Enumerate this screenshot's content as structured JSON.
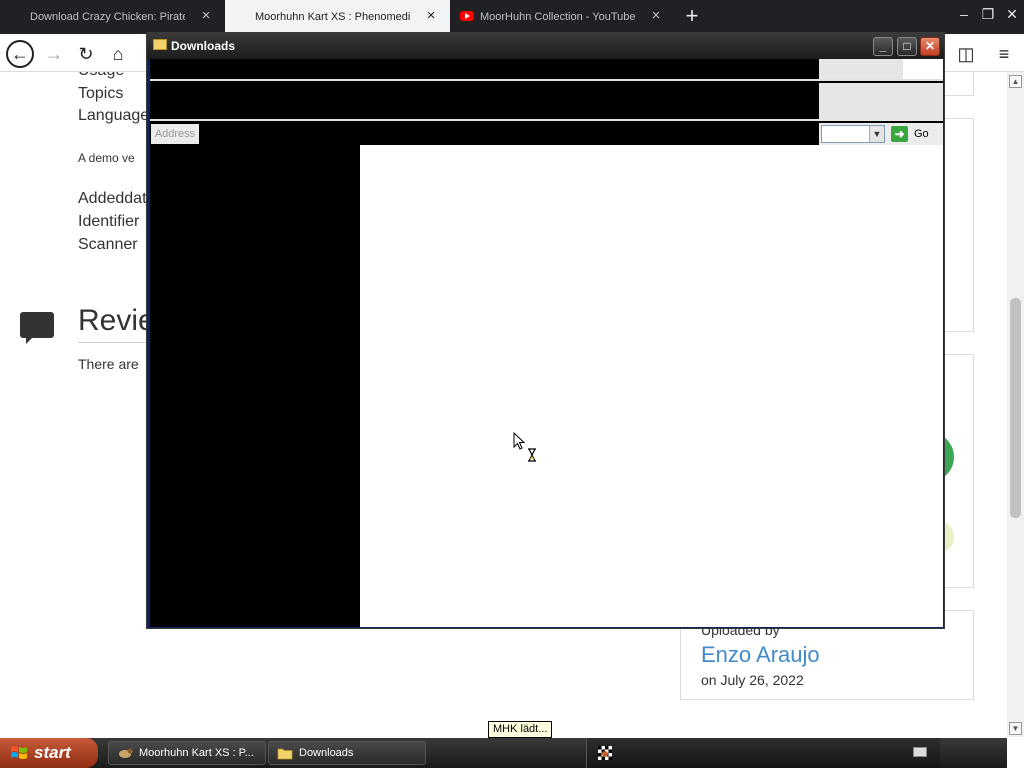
{
  "browser": {
    "tabs": [
      {
        "title": "Download Crazy Chicken: Pirates (",
        "close": "×"
      },
      {
        "title": "Moorhuhn Kart XS : Phenomedia : F",
        "close": "×",
        "active": true
      },
      {
        "title": "MoorHuhn Collection - YouTube",
        "close": "×"
      }
    ],
    "new_tab": "+",
    "window_controls": {
      "minimize": "–",
      "restore": "❐",
      "close": "✕"
    },
    "toolbar": {
      "back": "←",
      "forward": "→",
      "reload": "↻",
      "home": "⌂",
      "sidebar": "◫",
      "menu": "≡"
    }
  },
  "page": {
    "metadata_labels": [
      "Usage",
      "Topics",
      "Language"
    ],
    "demo_text": "A demo ve",
    "metadata_labels2": [
      "Addeddat",
      "Identifier",
      "Scanner"
    ],
    "reviews": {
      "title": "Revie",
      "empty_text": "There are"
    },
    "uploader": {
      "label": "Uploaded by",
      "name": "Enzo Araujo",
      "date": "on July 26, 2022"
    }
  },
  "scrollbar": {
    "up": "▲",
    "down": "▼"
  },
  "explorer": {
    "title": "Downloads",
    "buttons": {
      "minimize": "_",
      "maximize": "□",
      "close": "✕"
    },
    "address_label": "Address",
    "go_label": "Go",
    "go_arrow": "➜",
    "combo_arrow": "▼"
  },
  "tooltip": "MHK lädt...",
  "taskbar": {
    "start_label": "start",
    "items": [
      {
        "label": "Moorhuhn Kart XS : P...",
        "icon": "chicken-icon"
      },
      {
        "label": "Downloads",
        "icon": "folder-icon"
      }
    ]
  },
  "colors": {
    "xp_title_bar": "#2a2a2a",
    "start_button": "#b8461f",
    "uploader_link": "#428bca",
    "green_badge": "#3aa757"
  }
}
